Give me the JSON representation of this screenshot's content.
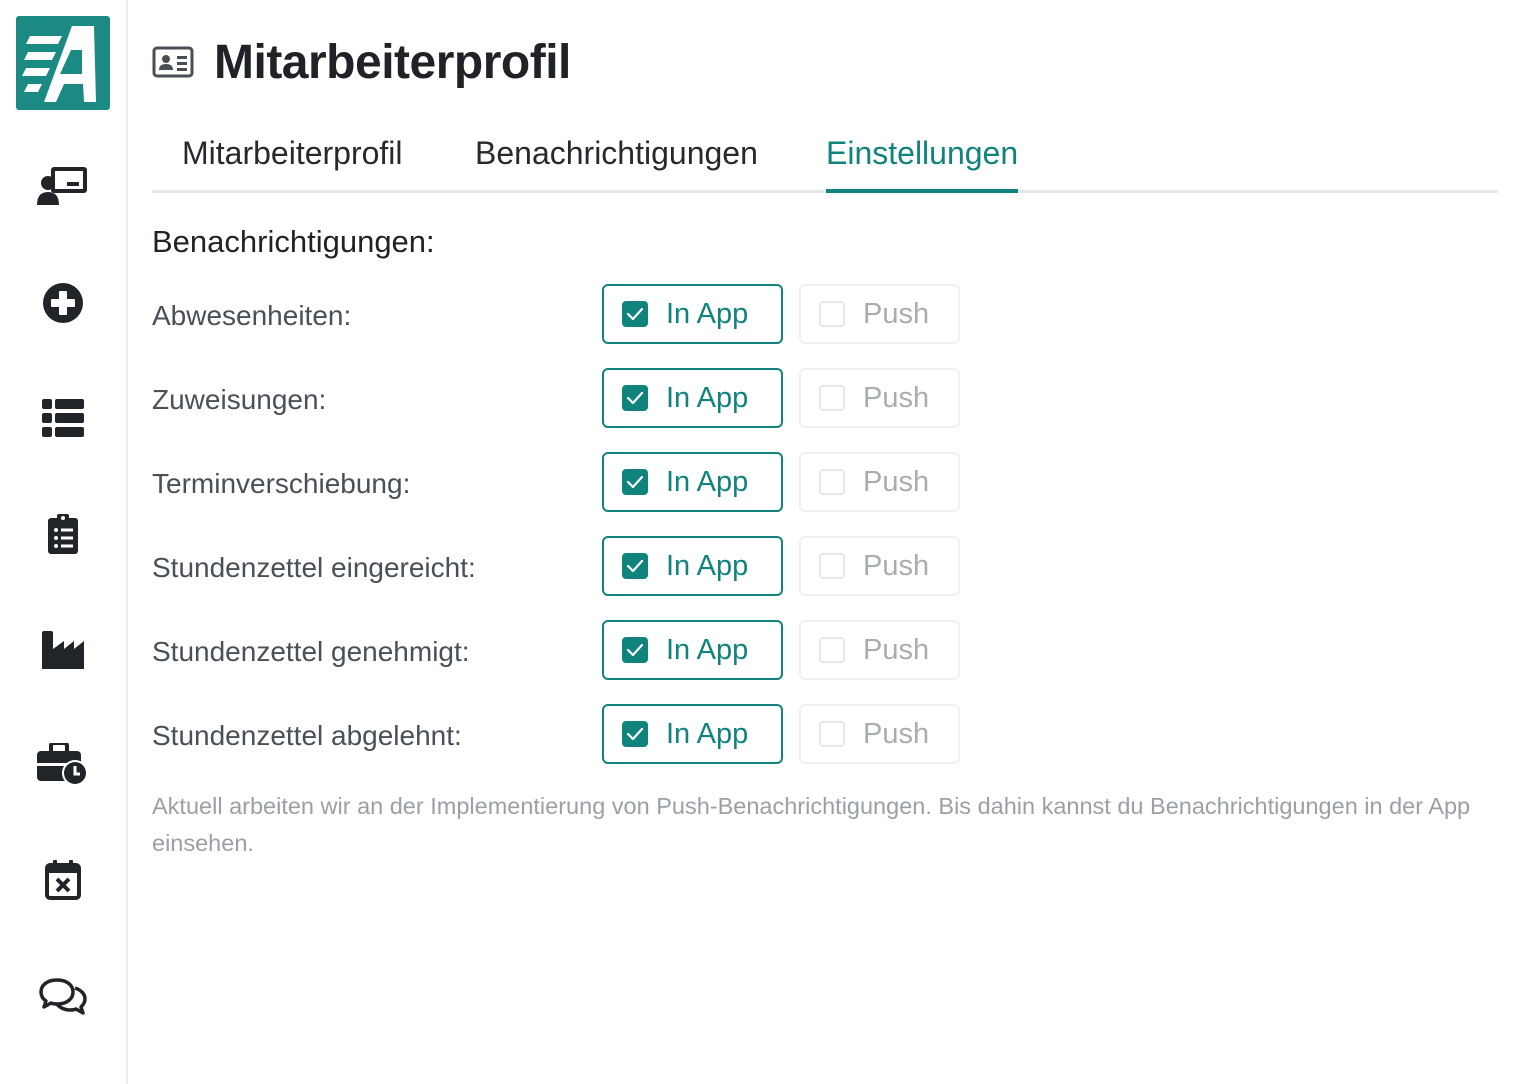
{
  "header": {
    "title": "Mitarbeiterprofil"
  },
  "tabs": [
    {
      "label": "Mitarbeiterprofil",
      "active": false
    },
    {
      "label": "Benachrichtigungen",
      "active": false
    },
    {
      "label": "Einstellungen",
      "active": true
    }
  ],
  "section": {
    "title": "Benachrichtigungen:"
  },
  "options": {
    "in_app_label": "In App",
    "push_label": "Push"
  },
  "rows": [
    {
      "label": "Abwesenheiten:",
      "in_app": true,
      "push": false
    },
    {
      "label": "Zuweisungen:",
      "in_app": true,
      "push": false
    },
    {
      "label": "Terminverschiebung:",
      "in_app": true,
      "push": false
    },
    {
      "label": "Stundenzettel eingereicht:",
      "in_app": true,
      "push": false
    },
    {
      "label": "Stundenzettel genehmigt:",
      "in_app": true,
      "push": false
    },
    {
      "label": "Stundenzettel abgelehnt:",
      "in_app": true,
      "push": false
    }
  ],
  "note": "Aktuell arbeiten wir an der Implementierung von Push-Benachrichtigungen. Bis dahin kannst du Benachrichtigungen in der App einsehen.",
  "sidebar": {
    "items": [
      {
        "icon": "presentation-user-icon"
      },
      {
        "icon": "plus-circle-icon"
      },
      {
        "icon": "list-icon"
      },
      {
        "icon": "clipboard-list-icon"
      },
      {
        "icon": "industry-icon"
      },
      {
        "icon": "briefcase-clock-icon"
      },
      {
        "icon": "calendar-x-icon"
      },
      {
        "icon": "comments-icon"
      }
    ]
  },
  "colors": {
    "accent": "#10847c",
    "logo_bg": "#1b8a83",
    "muted_text": "#9aa0a6",
    "icon": "#212529"
  }
}
